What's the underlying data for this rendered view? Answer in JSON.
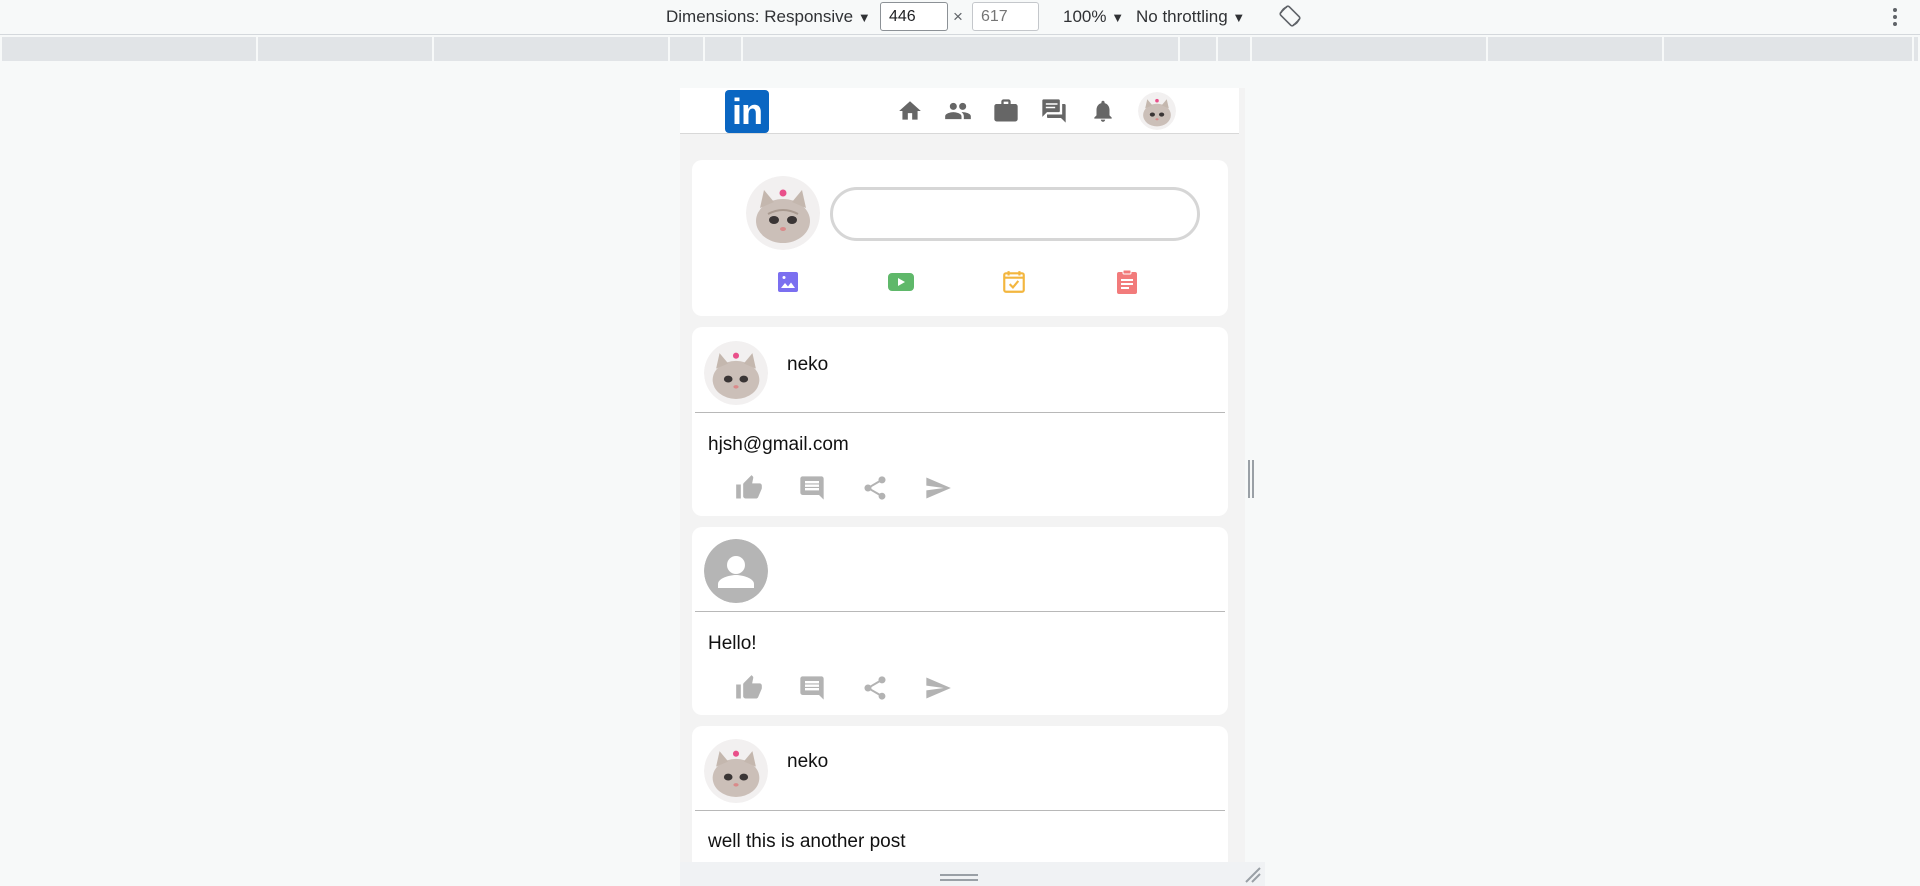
{
  "devtools": {
    "dimensions_label": "Dimensions: Responsive",
    "width_value": "446",
    "height_value": "617",
    "times": "×",
    "zoom": "100%",
    "throttling": "No throttling",
    "caret": "▼"
  },
  "app": {
    "logo_text": "in",
    "brand_color": "#0a66c2",
    "nav_icons": [
      "home-icon",
      "people-icon",
      "briefcase-icon",
      "chat-icon",
      "bell-icon"
    ],
    "composer": {
      "placeholder": "",
      "actions": [
        {
          "name": "photo-icon",
          "color": "#7b6ff0"
        },
        {
          "name": "video-icon",
          "color": "#5fb86a"
        },
        {
          "name": "event-icon",
          "color": "#f3b63f"
        },
        {
          "name": "article-icon",
          "color": "#f27b7b"
        }
      ]
    },
    "posts": [
      {
        "author": "neko",
        "body": "hjsh@gmail.com",
        "avatar": "cat"
      },
      {
        "author": "",
        "body": "Hello!",
        "avatar": "default"
      },
      {
        "author": "neko",
        "body": "well this is another post",
        "avatar": "cat"
      }
    ],
    "post_actions": [
      "like-icon",
      "comment-icon",
      "share-icon",
      "send-icon"
    ]
  }
}
